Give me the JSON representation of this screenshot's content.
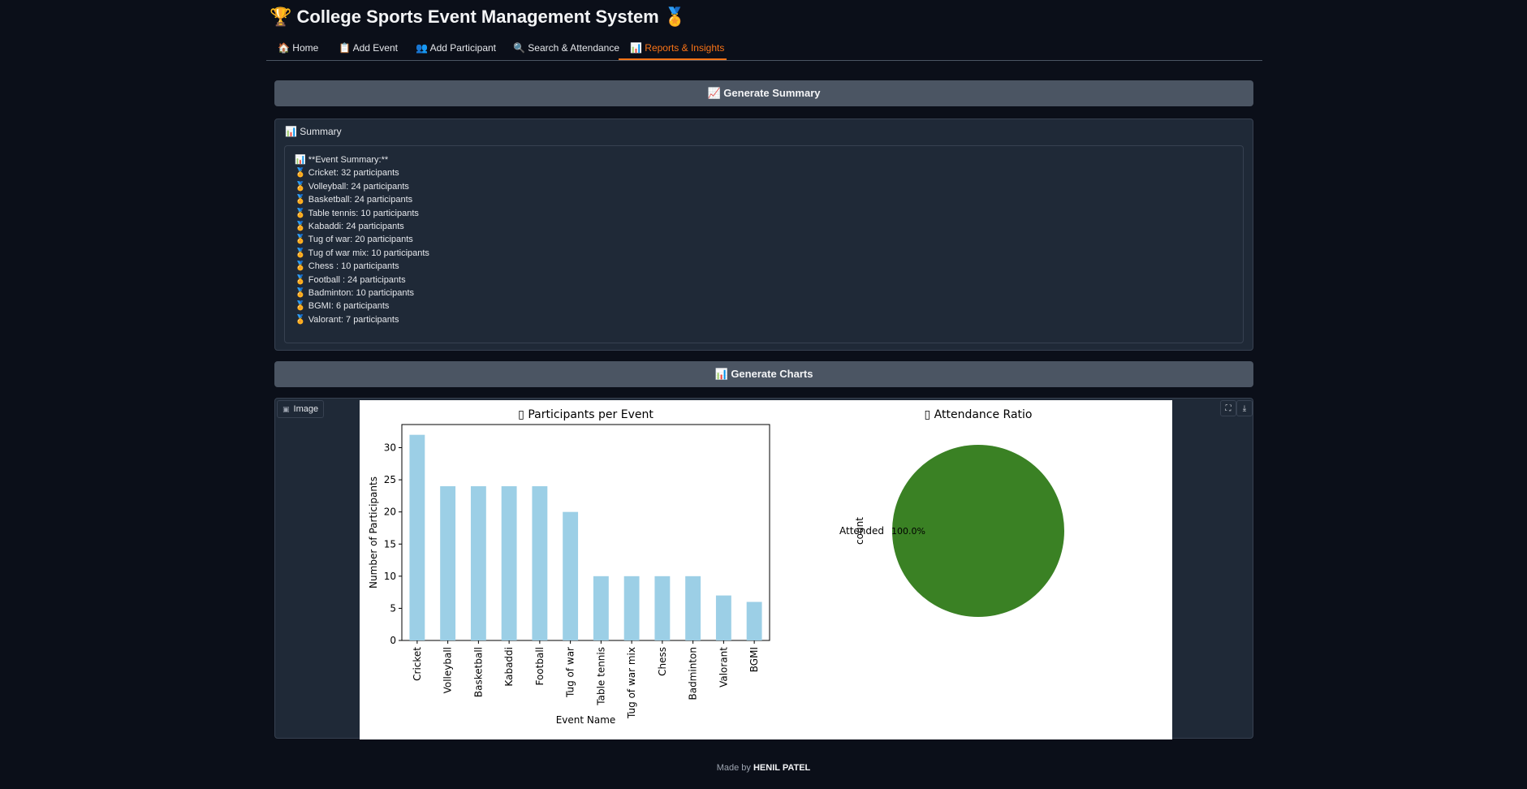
{
  "app": {
    "title": "🏆 College Sports Event Management System 🏅",
    "tabs": [
      {
        "label": "🏠 Home"
      },
      {
        "label": "📋 Add Event"
      },
      {
        "label": "👥 Add Participant"
      },
      {
        "label": "🔍 Search & Attendance"
      },
      {
        "label": "📊 Reports & Insights"
      }
    ],
    "active_tab": "📊 Reports & Insights"
  },
  "summary": {
    "button_label": "📈 Generate Summary",
    "panel_label": "📊 Summary",
    "lines": [
      "📊 **Event Summary:**",
      "🏅 Cricket: 32 participants",
      "🏅 Volleyball: 24 participants",
      "🏅 Basketball: 24 participants",
      "🏅 Table tennis: 10 participants",
      "🏅 Kabaddi: 24 participants",
      "🏅 Tug of war: 20 participants",
      "🏅 Tug of war mix: 10 participants",
      "🏅 Chess : 10 participants",
      "🏅 Football : 24 participants",
      "🏅 Badminton: 10 participants",
      "🏅 BGMI: 6 participants",
      "🏅 Valorant: 7 participants"
    ]
  },
  "charts_section": {
    "button_label": "📊 Generate Charts",
    "image_label": "Image",
    "fullscreen_icon": "fullscreen-icon",
    "download_icon": "download-icon"
  },
  "footer": {
    "prefix": "Made by",
    "author": "HENIL PATEL"
  },
  "colors": {
    "accent": "#f97316",
    "bar": "#9ccfe6",
    "pie": "#3a8124"
  },
  "chart_data": [
    {
      "type": "bar",
      "title": "▯ Participants per Event",
      "xlabel": "Event Name",
      "ylabel": "Number of Participants",
      "categories": [
        "Cricket",
        "Volleyball",
        "Basketball",
        "Kabaddi",
        "Football",
        "Tug of war",
        "Table tennis",
        "Tug of war mix",
        "Chess",
        "Badminton",
        "Valorant",
        "BGMI"
      ],
      "values": [
        32,
        24,
        24,
        24,
        24,
        20,
        10,
        10,
        10,
        10,
        7,
        6
      ],
      "ylim": [
        0,
        33.6
      ],
      "yticks": [
        0,
        5,
        10,
        15,
        20,
        25,
        30
      ],
      "grid": false
    },
    {
      "type": "pie",
      "title": "▯ Attendance Ratio",
      "ylabel": "count",
      "labels": [
        "Attended"
      ],
      "values": [
        100.0
      ],
      "pct_labels": [
        "100.0%"
      ]
    }
  ]
}
